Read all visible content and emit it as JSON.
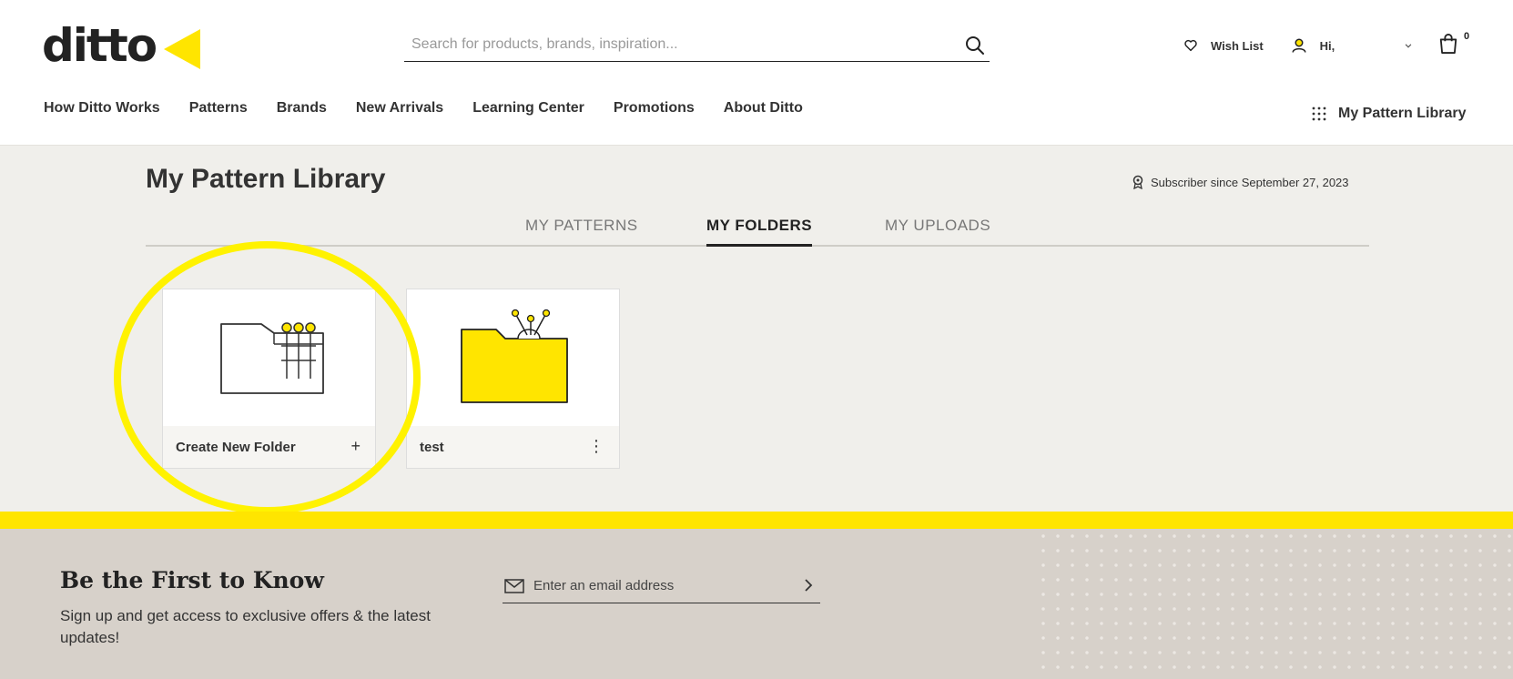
{
  "header": {
    "logo_text": "ditto",
    "search_placeholder": "Search for products, brands, inspiration...",
    "wish_list_label": "Wish List",
    "greeting": "Hi,",
    "cart_count": "0",
    "nav": [
      "How Ditto Works",
      "Patterns",
      "Brands",
      "New Arrivals",
      "Learning Center",
      "Promotions",
      "About Ditto"
    ],
    "library_link": "My Pattern Library"
  },
  "main": {
    "title": "My Pattern Library",
    "subscriber_text": "Subscriber since September 27, 2023",
    "tabs": [
      {
        "label": "MY PATTERNS",
        "active": false
      },
      {
        "label": "MY FOLDERS",
        "active": true
      },
      {
        "label": "MY UPLOADS",
        "active": false
      }
    ],
    "folders": [
      {
        "label": "Create New Folder",
        "action": "+"
      },
      {
        "label": "test",
        "action": "⋮"
      }
    ]
  },
  "footer": {
    "title": "Be the First to Know",
    "subtitle": "Sign up and get access to exclusive offers & the latest updates!",
    "email_placeholder": "Enter an email address"
  },
  "colors": {
    "brand_yellow": "#ffe500",
    "highlight_ring": "#fff200",
    "main_bg": "#f0efeb",
    "footer_bg": "#d7d1ca"
  },
  "icons": [
    "search-icon",
    "heart-icon",
    "user-icon",
    "chevron-down-icon",
    "shopping-bag-icon",
    "grid-dots-icon",
    "award-ribbon-icon",
    "folder-pins-outline-icon",
    "folder-pins-yellow-icon",
    "mail-icon",
    "chevron-right-icon"
  ]
}
